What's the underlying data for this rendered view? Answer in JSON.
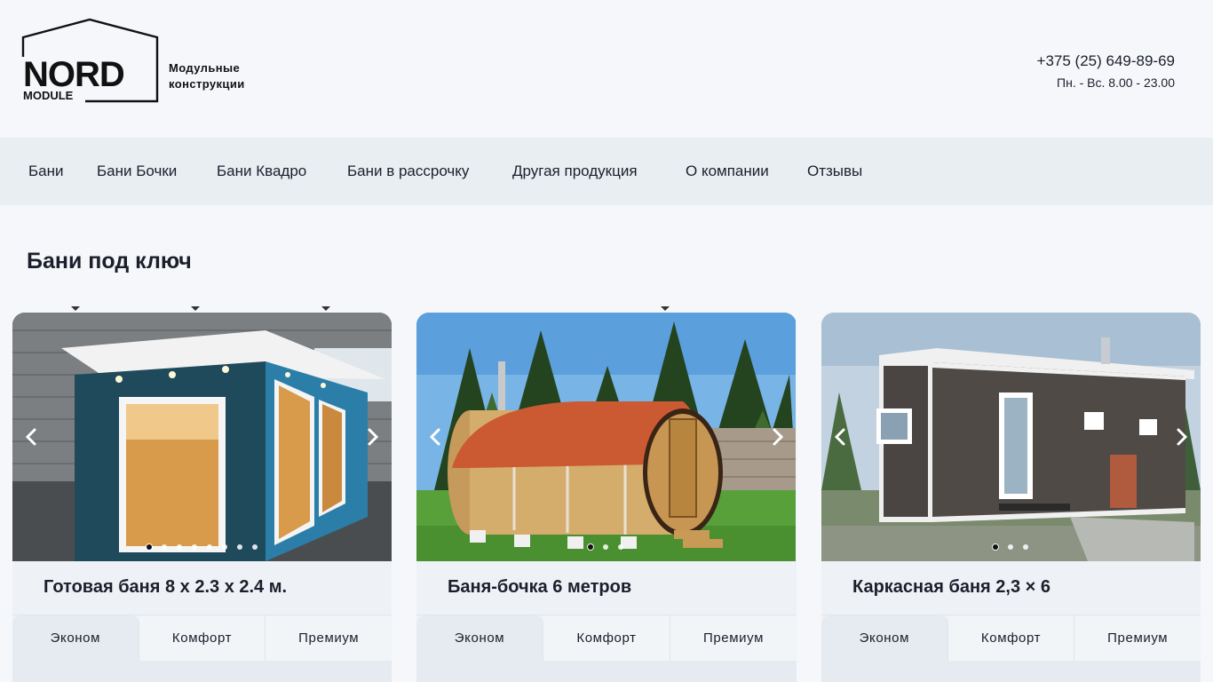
{
  "header": {
    "logo_word": "NORD",
    "logo_sub": "MODULE",
    "logo_tagline_line1": "Модульные",
    "logo_tagline_line2": "конструкции",
    "phone": "+375 (25) 649-89-69",
    "hours": "Пн. - Вс. 8.00 - 23.00"
  },
  "nav": {
    "items": [
      {
        "label": "Бани",
        "has_dropdown": true
      },
      {
        "label": "Бани Бочки",
        "has_dropdown": true
      },
      {
        "label": "Бани Квадро",
        "has_dropdown": true
      },
      {
        "label": "Бани в рассрочку",
        "has_dropdown": false
      },
      {
        "label": "Другая продукция",
        "has_dropdown": true
      },
      {
        "label": "О компании",
        "has_dropdown": false
      },
      {
        "label": "Отзывы",
        "has_dropdown": false
      }
    ]
  },
  "section": {
    "title": "Бани под ключ"
  },
  "cards": [
    {
      "title": "Готовая баня 8 х 2.3 х 2.4 м.",
      "slide_count": 8,
      "active_slide": 1,
      "tabs": [
        "Эконом",
        "Комфорт",
        "Премиум"
      ],
      "active_tab": 0
    },
    {
      "title": "Баня-бочка 6 метров",
      "slide_count": 3,
      "active_slide": 1,
      "tabs": [
        "Эконом",
        "Комфорт",
        "Премиум"
      ],
      "active_tab": 0
    },
    {
      "title": "Каркасная баня 2,3 × 6",
      "slide_count": 3,
      "active_slide": 1,
      "tabs": [
        "Эконом",
        "Комфорт",
        "Премиум"
      ],
      "active_tab": 0
    }
  ],
  "colors": {
    "page_bg": "#f5f7fa",
    "nav_bg": "#e9eef3",
    "text": "#1c1f2b",
    "tab_active_bg": "#e6eaf1"
  },
  "icons": {
    "prev": "chevron-left-icon",
    "next": "chevron-right-icon",
    "dropdown": "caret-down-icon",
    "logo": "house-outline-icon"
  }
}
